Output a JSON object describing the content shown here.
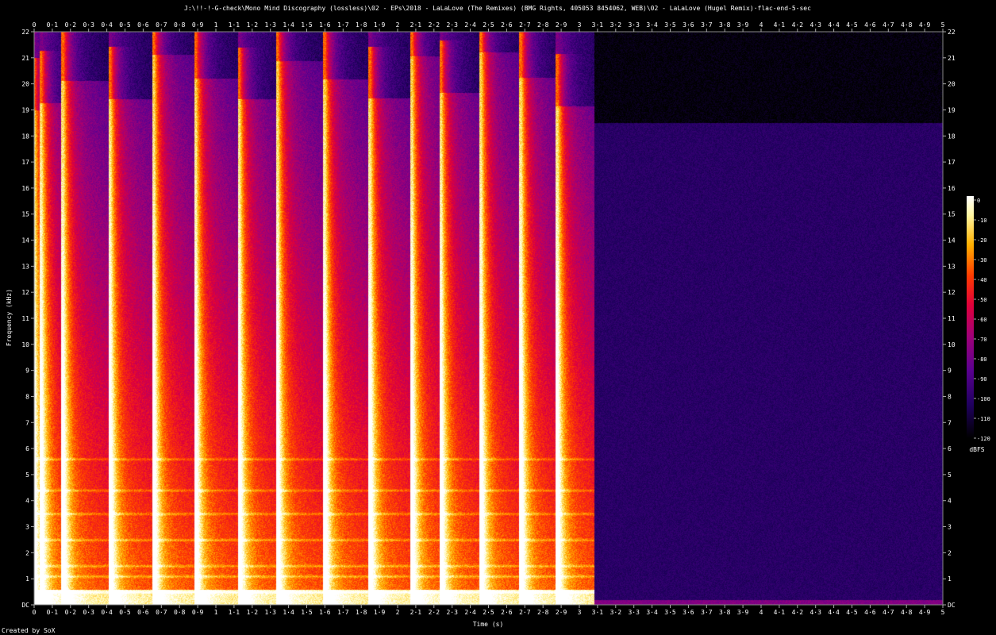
{
  "chart_data": {
    "type": "heatmap",
    "title": "J:\\!!-!-G-check\\Mono Mind Discography (lossless)\\02 - EPs\\2018 - LaLaLove (The Remixes) (BMG Rights, 405053 8454062, WEB)\\02 - LaLaLove (Hugel Remix)·flac-end-5-sec",
    "xlabel": "Time (s)",
    "ylabel": "Frequency (kHz)",
    "xlim": [
      0,
      5
    ],
    "ylim": [
      0,
      22
    ],
    "x_ticks": [
      "0",
      "0·1",
      "0·2",
      "0·3",
      "0·4",
      "0·5",
      "0·6",
      "0·7",
      "0·8",
      "0·9",
      "1",
      "1·1",
      "1·2",
      "1·3",
      "1·4",
      "1·5",
      "1·6",
      "1·7",
      "1·8",
      "1·9",
      "2",
      "2·1",
      "2·2",
      "2·3",
      "2·4",
      "2·5",
      "2·6",
      "2·7",
      "2·8",
      "2·9",
      "3",
      "3·1",
      "3·2",
      "3·3",
      "3·4",
      "3·5",
      "3·6",
      "3·7",
      "3·8",
      "3·9",
      "4",
      "4·1",
      "4·2",
      "4·3",
      "4·4",
      "4·5",
      "4·6",
      "4·7",
      "4·8",
      "4·9",
      "5"
    ],
    "y_ticks": [
      "DC",
      "1",
      "2",
      "3",
      "4",
      "5",
      "6",
      "7",
      "8",
      "9",
      "10",
      "11",
      "12",
      "13",
      "14",
      "15",
      "16",
      "17",
      "18",
      "19",
      "20",
      "21",
      "22"
    ],
    "colorbar": {
      "label": "dBFS",
      "ticks": [
        "0",
        "-10",
        "-20",
        "-30",
        "-40",
        "-50",
        "-60",
        "-70",
        "-80",
        "-90",
        "-100",
        "-110",
        "-120"
      ],
      "range": [
        -120,
        0
      ]
    },
    "audio_end_time": 3.08,
    "transients": [
      0.04,
      0.16,
      0.42,
      0.66,
      0.89,
      1.13,
      1.34,
      1.6,
      1.85,
      2.08,
      2.24,
      2.46,
      2.68,
      2.88
    ],
    "tonal_bands_khz": [
      0.5,
      1.1,
      1.5,
      2.5,
      3.5,
      4.4,
      5.6
    ],
    "credit": "Created by SoX"
  }
}
